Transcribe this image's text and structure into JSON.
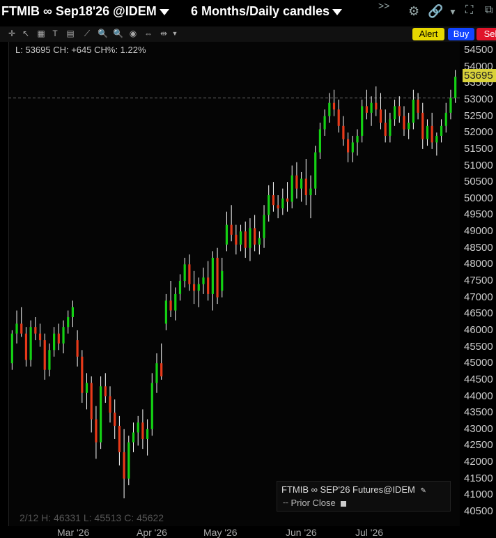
{
  "header": {
    "instrument": "FTMIB ∞ Sep18'26 @IDEM",
    "range": "6 Months/Daily candles",
    "overflow": ">>"
  },
  "buttons": {
    "alert": "Alert",
    "buy": "Buy",
    "sell": "Sel"
  },
  "readout": {
    "top": "L: 53695 CH: +645 CH%: 1.22%",
    "bottom": "2/12  H: 46331  L: 45513  C: 45622"
  },
  "last_price": "53695",
  "legend": {
    "title": "FTMIB ∞ SEP'26 Futures@IDEM",
    "item": "Prior Close"
  },
  "x_labels": [
    "Mar '26",
    "Apr '26",
    "May '26",
    "Jun '26",
    "Jul '26"
  ],
  "colors": {
    "up": "#14d114",
    "down": "#e83a1a",
    "wick": "#ffffff",
    "last_tag": "#d9d23a"
  },
  "chart_data": {
    "type": "candlestick",
    "ylim": [
      40500,
      54500
    ],
    "yticks": [
      54500,
      54000,
      53500,
      53000,
      52500,
      52000,
      51500,
      51000,
      50500,
      50000,
      49500,
      49000,
      48500,
      48000,
      47500,
      47000,
      46500,
      46000,
      45500,
      45000,
      44500,
      44000,
      43500,
      43000,
      42500,
      42000,
      41500,
      41000,
      40500
    ],
    "prior_close": 53050,
    "last": 53695,
    "candles": [
      [
        45000,
        46000,
        44800,
        45900
      ],
      [
        45900,
        46600,
        45600,
        46200
      ],
      [
        46200,
        46700,
        45800,
        45900
      ],
      [
        45900,
        46100,
        44900,
        45100
      ],
      [
        45100,
        46300,
        44900,
        46100
      ],
      [
        46100,
        46400,
        45700,
        45900
      ],
      [
        45900,
        46200,
        45500,
        45700
      ],
      [
        45700,
        45900,
        44500,
        44800
      ],
      [
        44800,
        45600,
        44600,
        45400
      ],
      [
        45400,
        46100,
        45200,
        45900
      ],
      [
        45900,
        46200,
        45400,
        45600
      ],
      [
        45600,
        46300,
        45300,
        46100
      ],
      [
        46100,
        46600,
        45900,
        46400
      ],
      [
        46400,
        46900,
        46100,
        46700
      ],
      [
        45700,
        46000,
        44900,
        45200
      ],
      [
        45200,
        45400,
        43800,
        44100
      ],
      [
        44100,
        44700,
        43600,
        44400
      ],
      [
        44400,
        44600,
        42900,
        43300
      ],
      [
        43300,
        43700,
        42100,
        42600
      ],
      [
        42600,
        44600,
        42400,
        44300
      ],
      [
        44300,
        44700,
        43800,
        44000
      ],
      [
        44000,
        44300,
        43200,
        43500
      ],
      [
        43500,
        43900,
        42700,
        43100
      ],
      [
        43100,
        43400,
        41900,
        42300
      ],
      [
        42300,
        43000,
        40900,
        41500
      ],
      [
        41500,
        42800,
        41300,
        42600
      ],
      [
        42600,
        43200,
        42300,
        42900
      ],
      [
        42900,
        43400,
        42500,
        43200
      ],
      [
        43200,
        43600,
        42400,
        42700
      ],
      [
        42700,
        43300,
        42200,
        43000
      ],
      [
        43000,
        44700,
        42800,
        44400
      ],
      [
        44400,
        45300,
        44100,
        45000
      ],
      [
        45000,
        45600,
        44500,
        44600
      ],
      [
        46200,
        47100,
        46000,
        46900
      ],
      [
        46900,
        47500,
        46400,
        46600
      ],
      [
        46600,
        47300,
        46300,
        47100
      ],
      [
        47100,
        47700,
        46900,
        47500
      ],
      [
        47500,
        48200,
        47300,
        48000
      ],
      [
        48000,
        48300,
        47200,
        47400
      ],
      [
        47400,
        47800,
        46800,
        47200
      ],
      [
        47200,
        47600,
        46700,
        47400
      ],
      [
        47400,
        47900,
        47100,
        47600
      ],
      [
        47600,
        48100,
        46900,
        47100
      ],
      [
        47100,
        48400,
        46600,
        48200
      ],
      [
        48200,
        48500,
        46800,
        47000
      ],
      [
        47200,
        48200,
        47000,
        47800
      ],
      [
        48600,
        49600,
        48400,
        49200
      ],
      [
        49200,
        49800,
        48700,
        48900
      ],
      [
        48900,
        49200,
        48300,
        48600
      ],
      [
        48600,
        49200,
        48400,
        49000
      ],
      [
        49000,
        49300,
        48200,
        48500
      ],
      [
        48500,
        49400,
        48100,
        49100
      ],
      [
        49100,
        49500,
        48400,
        48600
      ],
      [
        48600,
        49000,
        48300,
        48800
      ],
      [
        48800,
        49800,
        48500,
        49500
      ],
      [
        49500,
        50400,
        49300,
        50100
      ],
      [
        50100,
        50500,
        49600,
        49800
      ],
      [
        49800,
        50100,
        49400,
        49700
      ],
      [
        49700,
        50300,
        49500,
        50000
      ],
      [
        50000,
        50500,
        49600,
        49900
      ],
      [
        49900,
        51000,
        49700,
        50700
      ],
      [
        50700,
        51100,
        50000,
        50300
      ],
      [
        50300,
        50800,
        49900,
        50600
      ],
      [
        50600,
        51200,
        49800,
        50100
      ],
      [
        50100,
        50700,
        49400,
        50300
      ],
      [
        50300,
        51600,
        50100,
        51400
      ],
      [
        51400,
        52300,
        51200,
        52100
      ],
      [
        52100,
        52700,
        51900,
        52500
      ],
      [
        52500,
        53200,
        52300,
        52900
      ],
      [
        52900,
        53300,
        52500,
        52700
      ],
      [
        52700,
        53000,
        52000,
        52200
      ],
      [
        52200,
        52500,
        51600,
        51800
      ],
      [
        51800,
        52000,
        51100,
        51400
      ],
      [
        51400,
        51900,
        51100,
        51700
      ],
      [
        51700,
        52100,
        51300,
        51900
      ],
      [
        51900,
        53000,
        51700,
        52800
      ],
      [
        52800,
        53300,
        52400,
        52600
      ],
      [
        52600,
        53100,
        52200,
        52900
      ],
      [
        52900,
        53400,
        52500,
        52700
      ],
      [
        52700,
        53200,
        52100,
        52300
      ],
      [
        52300,
        52700,
        51700,
        51900
      ],
      [
        51900,
        52600,
        51700,
        52400
      ],
      [
        52400,
        53000,
        52200,
        52800
      ],
      [
        52800,
        53100,
        52300,
        52500
      ],
      [
        52500,
        52800,
        51900,
        52100
      ],
      [
        52100,
        52600,
        51800,
        52300
      ],
      [
        52300,
        53300,
        52100,
        53000
      ],
      [
        53000,
        53200,
        52400,
        52600
      ],
      [
        52600,
        52900,
        51500,
        51800
      ],
      [
        51800,
        52400,
        51600,
        52200
      ],
      [
        52200,
        52600,
        51500,
        51700
      ],
      [
        51700,
        52000,
        51300,
        51900
      ],
      [
        51900,
        52400,
        51700,
        52200
      ],
      [
        52200,
        52900,
        52000,
        52600
      ],
      [
        52600,
        53300,
        52400,
        53050
      ],
      [
        53050,
        53900,
        52900,
        53695
      ]
    ]
  }
}
